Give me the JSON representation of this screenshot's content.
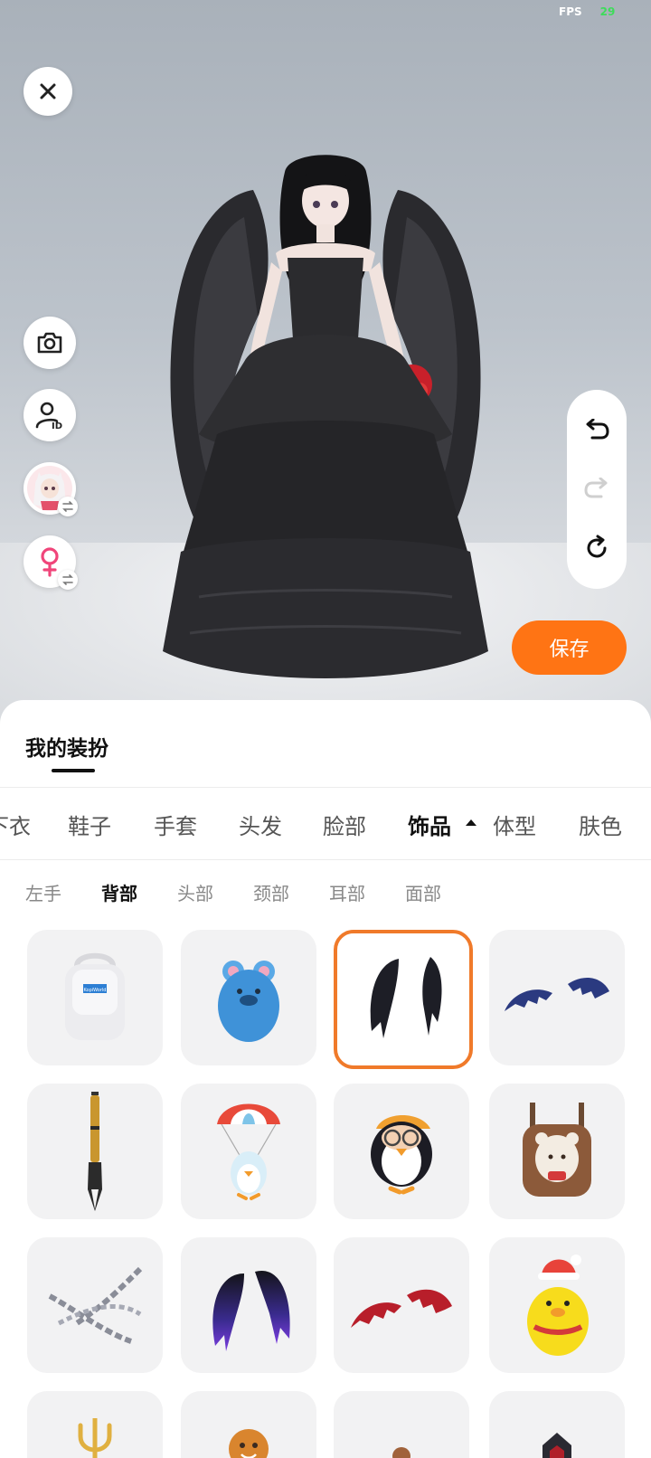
{
  "status": {
    "fps_label": "FPS",
    "fps_value": "29"
  },
  "stage": {
    "close_icon": "close-icon",
    "camera_icon": "camera-icon",
    "profile_id_icon": "profile-id-icon",
    "avatar_icon": "avatar-thumbnail",
    "gender_icon": "female-icon",
    "swap_icon": "swap-icon",
    "undo_icon": "undo-icon",
    "redo_icon": "redo-icon",
    "reset_icon": "reset-icon",
    "save_label": "保存"
  },
  "sheet": {
    "title": "我的装扮",
    "categories": [
      "下衣",
      "鞋子",
      "手套",
      "头发",
      "脸部",
      "饰品",
      "体型",
      "肤色"
    ],
    "active_category": "饰品",
    "subcategories": [
      "左手",
      "背部",
      "头部",
      "颈部",
      "耳部",
      "面部"
    ],
    "active_subcategory": "背部",
    "items": [
      {
        "name": "white-backpack",
        "label": "KopiWorld"
      },
      {
        "name": "blue-mouse-backpack",
        "label": ""
      },
      {
        "name": "black-feather-wings",
        "label": "",
        "selected": true
      },
      {
        "name": "bat-wings",
        "label": ""
      },
      {
        "name": "calligraphy-brush",
        "label": ""
      },
      {
        "name": "penguin-parachute",
        "label": ""
      },
      {
        "name": "penguin-glasses",
        "label": ""
      },
      {
        "name": "bear-backpack",
        "label": ""
      },
      {
        "name": "chains",
        "label": ""
      },
      {
        "name": "purple-gradient-wings",
        "label": ""
      },
      {
        "name": "red-devil-wings",
        "label": ""
      },
      {
        "name": "yellow-duck-santa",
        "label": ""
      },
      {
        "name": "golden-trident",
        "label": ""
      },
      {
        "name": "gingerbread-man",
        "label": ""
      },
      {
        "name": "brown-bag",
        "label": ""
      },
      {
        "name": "dark-box",
        "label": ""
      }
    ]
  },
  "colors": {
    "accent": "#ff7414",
    "selected_border": "#f07a2a",
    "female_pink": "#f0457a"
  }
}
